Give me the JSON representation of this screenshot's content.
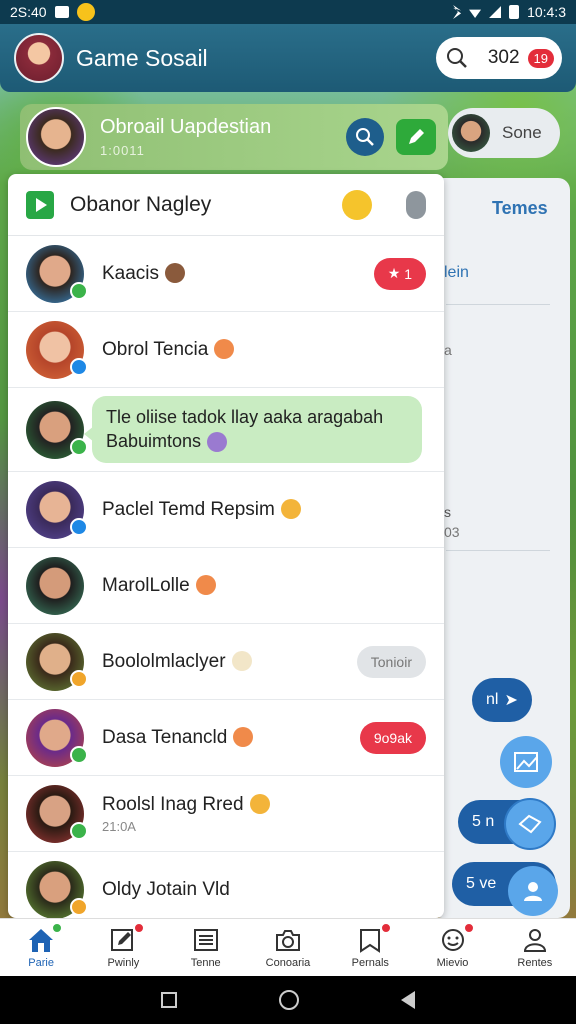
{
  "status_bar": {
    "time_left": "2S:40",
    "time_right": "10:4:3"
  },
  "header": {
    "title": "Game Sosail",
    "count": "302",
    "badge": "19"
  },
  "profile": {
    "name": "Obroail Uapdestian",
    "subtitle": "1:0011"
  },
  "side_user": {
    "label": "Sone"
  },
  "back_panel": {
    "header": "Temes",
    "line1": "lein",
    "line2": "a",
    "line3": "s",
    "line4": "03"
  },
  "sheet": {
    "title": "Obanor Nagley"
  },
  "chats": [
    {
      "name": "Kaacis",
      "pill": "1",
      "pill_style": "red",
      "presence_color": "#3bb34a"
    },
    {
      "name": "Obrol Tencia",
      "presence_color": "#1e88e5"
    },
    {
      "bubble": "Tle oliise tadok llay aaka aragabah Babuimtons",
      "presence_color": "#3bb34a"
    },
    {
      "name": "Paclel Temd Repsim",
      "presence_color": "#1e88e5"
    },
    {
      "name": "MarolLolle"
    },
    {
      "name": "Boololmlaclyer",
      "pill": "Tonioir",
      "pill_style": "grey",
      "presence_color": "#f0a52a"
    },
    {
      "name": "Dasa Tenancld",
      "pill": "9o9ak",
      "pill_style": "red",
      "presence_color": "#3bb34a"
    },
    {
      "name": "Roolsl Inag Rred",
      "sub": "21:0A",
      "presence_color": "#3bb34a"
    },
    {
      "name": "Oldy Jotain Vld",
      "presence_color": "#f0a52a"
    }
  ],
  "fabs": {
    "pill1": "nl",
    "pill2": "5 n",
    "pill3": "5 ve"
  },
  "bottom_nav": [
    {
      "label": "Parie",
      "active": true
    },
    {
      "label": "Pwinly"
    },
    {
      "label": "Tenne"
    },
    {
      "label": "Conoaria"
    },
    {
      "label": "Pernals"
    },
    {
      "label": "Mievio"
    },
    {
      "label": "Rentes"
    }
  ],
  "colors": {
    "header": "#1d5a75",
    "accent_blue": "#1e63b4",
    "badge_red": "#e32d3a",
    "bubble_green": "#c9ecc2"
  }
}
